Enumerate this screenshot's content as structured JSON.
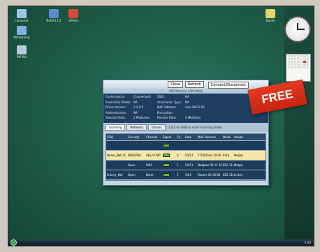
{
  "desktop": {
    "icons": [
      {
        "label": "Computer",
        "color": "#9fc4e6"
      },
      {
        "label": "NetSCI 2.2",
        "color": "#5a8cc8"
      },
      {
        "label": "XP/Vst",
        "color": "#d24b3c"
      },
      {
        "label": "Networking",
        "color": "#7fb0e0"
      },
      {
        "label": "Pdf Wiz",
        "color": "#b8c8d8"
      },
      {
        "label": "Books",
        "color": "#e8d36a"
      }
    ]
  },
  "window": {
    "toolbar": {
      "close_label": "Close",
      "refresh_label": "Refresh",
      "connect_label": "Connect/Disconnect"
    },
    "title": "USB Wireless LAN Utility",
    "info": [
      [
        "Connected to:",
        "[Connected]",
        "SSID:",
        "NA"
      ],
      [
        "Association Mode:",
        "NA",
        "Association Type:",
        "NA"
      ],
      [
        "Driver Version:",
        "2.2.0.0",
        "MAC Address:",
        "Cool 00.F2.B3"
      ],
      [
        "Authentication:",
        "NA",
        "Encryption:",
        ""
      ],
      [
        "Transmit Rate:",
        "5 Mbits/sec",
        "Receive Rate:",
        "0 Mbits/sec"
      ]
    ],
    "tabs": [
      "Scanning",
      "Networks",
      "Drivers"
    ],
    "tab_hint": "Click on SSID to enter Scanning mode",
    "table": {
      "headers": [
        "SSID",
        "Security",
        "Channel",
        "Signal",
        "Ch",
        "Rate",
        "MAC Address",
        "Mode",
        "Vendor"
      ],
      "rows": [
        {
          "ssid": "",
          "security": "",
          "channel": "",
          "signal": "",
          "ch": "",
          "rate": "",
          "mac": "",
          "mode": "",
          "vendor": ""
        },
        {
          "ssid": "Home_Net.21",
          "security": "WPA2PSK",
          "channel": "AES-CCMP",
          "signal": "",
          "ch": "6",
          "rate": "54/17",
          "mac": "7700D2ee 10 0A 15 B53",
          "mode": "Infra",
          "vendor": "Netgear"
        },
        {
          "ssid": "",
          "security": "Open",
          "channel": "WEP",
          "signal": "",
          "ch": "1",
          "rate": "54/11",
          "mac": "Netgear 00 11 A2 B3",
          "mode": "802.11g",
          "vendor": "Netgear"
        },
        {
          "ssid": "linksys_Net",
          "security": "Open",
          "channel": "None",
          "signal": "",
          "ch": "1",
          "rate": "54/1",
          "mac": "Router 00 18 B2",
          "mode": "802.11b",
          "vendor": "Linksys"
        }
      ]
    }
  },
  "badge": {
    "label": "FREE"
  },
  "taskbar": {
    "tray_text": "2:44"
  }
}
